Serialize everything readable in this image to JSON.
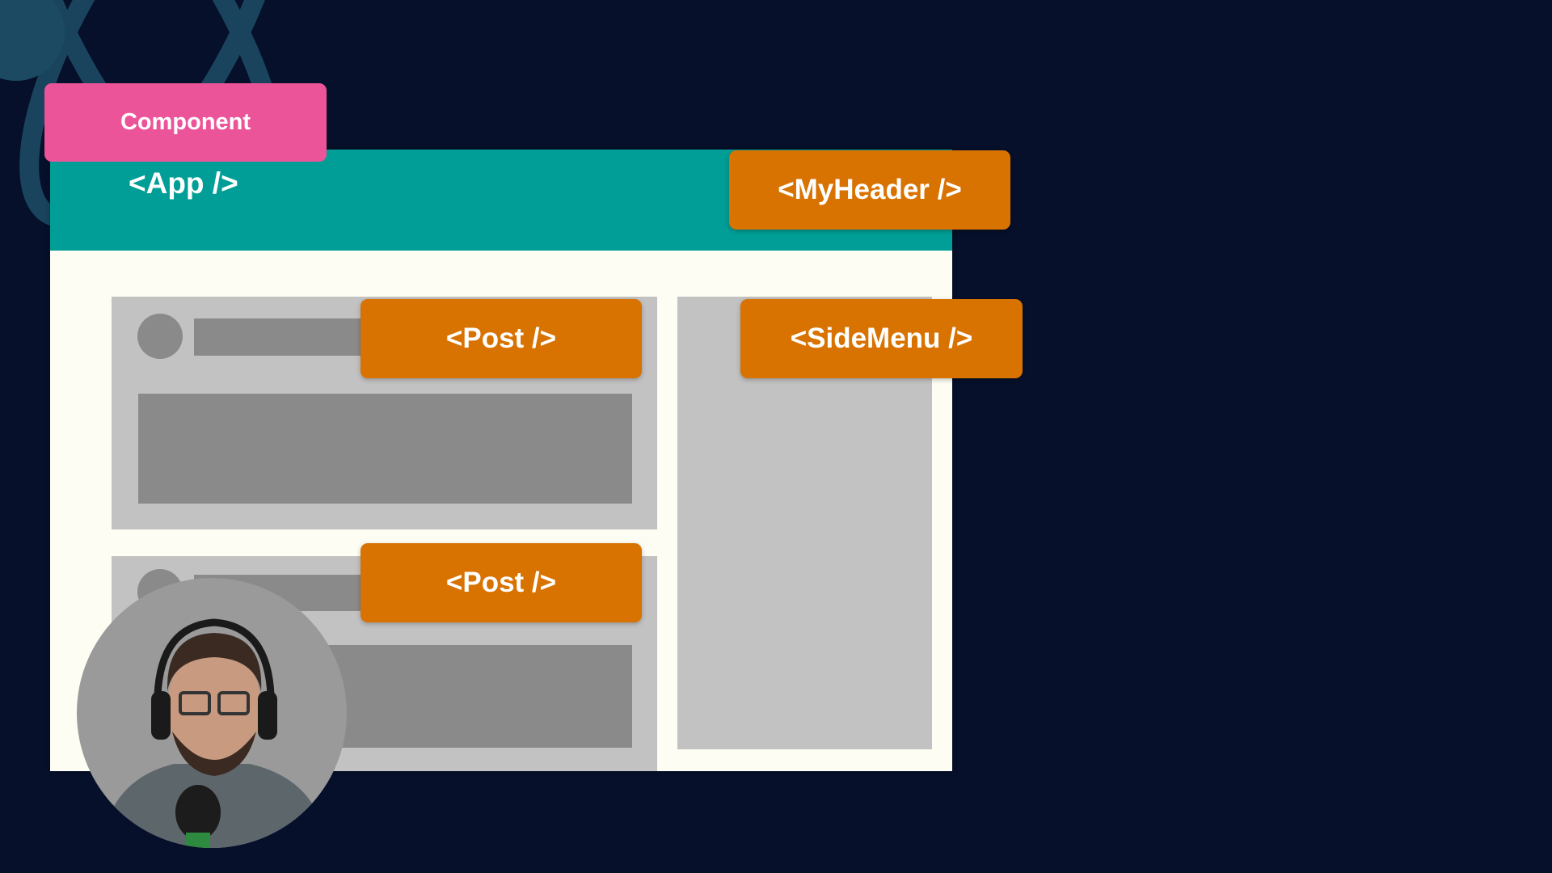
{
  "labels": {
    "component": "Component",
    "app": "<App />",
    "my_header": "<MyHeader />",
    "post_1": "<Post />",
    "side_menu": "<SideMenu />",
    "post_2": "<Post />"
  },
  "colors": {
    "background": "#06102a",
    "header": "#009e96",
    "component_tag": "#ec549a",
    "component_tags": "#d87200",
    "placeholder_light": "#c2c2c2",
    "placeholder_dark": "#8a8a8a"
  }
}
